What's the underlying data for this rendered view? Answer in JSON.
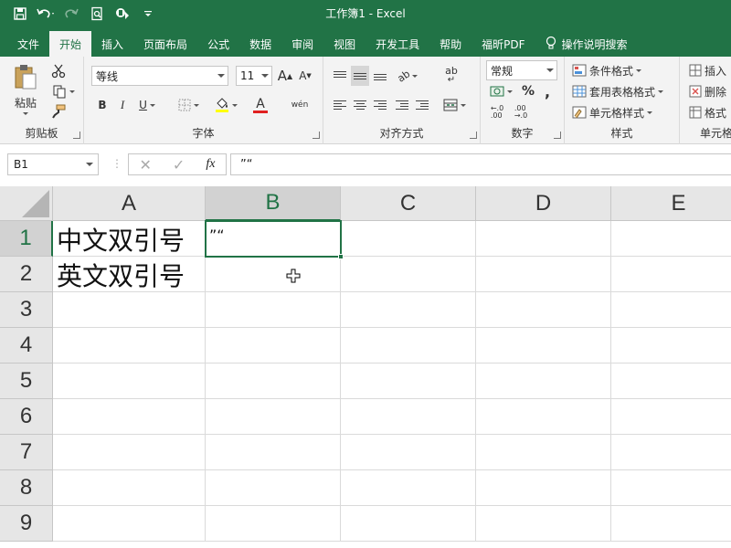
{
  "window": {
    "title": "工作簿1  -  Excel"
  },
  "qat": {
    "icons": [
      "save-icon",
      "undo-icon",
      "redo-icon",
      "print-preview-icon",
      "touch-mode-icon",
      "customize-icon"
    ]
  },
  "tabs": [
    "文件",
    "开始",
    "插入",
    "页面布局",
    "公式",
    "数据",
    "审阅",
    "视图",
    "开发工具",
    "帮助",
    "福昕PDF",
    "操作说明搜索"
  ],
  "active_tab": "开始",
  "ribbon": {
    "clipboard": {
      "label": "剪贴板",
      "paste": "粘贴"
    },
    "font": {
      "label": "字体",
      "name": "等线",
      "size": "11",
      "bold": "B",
      "italic": "I",
      "underline": "U",
      "font_color_glyph": "A",
      "phonetic": "wén",
      "grow": "A",
      "shrink": "A"
    },
    "alignment": {
      "label": "对齐方式",
      "orientation": "ab",
      "wrap": "ab"
    },
    "number": {
      "label": "数字",
      "format": "常规",
      "percent": "%",
      "comma": ",",
      "inc_decimal": "←.0\n.00",
      "dec_decimal": ".00\n→.0"
    },
    "styles": {
      "label": "样式",
      "conditional": "条件格式",
      "table": "套用表格格式",
      "cell": "单元格样式"
    },
    "cells": {
      "label": "单元格",
      "insert": "插入",
      "delete": "删除",
      "format": "格式"
    }
  },
  "formula_bar": {
    "name_box": "B1",
    "content": "”“",
    "fx": "fx"
  },
  "columns": [
    "A",
    "B",
    "C",
    "D",
    "E"
  ],
  "rows": [
    "1",
    "2",
    "3",
    "4",
    "5",
    "6",
    "7",
    "8",
    "9"
  ],
  "cells": {
    "A1": "中文双引号",
    "A2": "英文双引号",
    "B1": "”“"
  },
  "selected_cell": "B1",
  "colors": {
    "brand": "#217346",
    "header_bg": "#e6e6e6",
    "gridline": "#dadada"
  }
}
